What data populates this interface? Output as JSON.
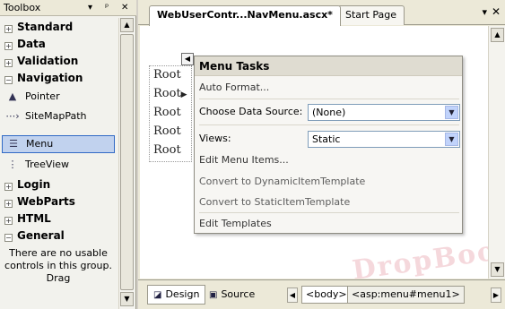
{
  "toolbox": {
    "title": "Toolbox",
    "pin_glyph": "▾ ᵖ",
    "close_glyph": "✕",
    "groups": [
      {
        "label": "Standard",
        "expander": "+"
      },
      {
        "label": "Data",
        "expander": "+"
      },
      {
        "label": "Validation",
        "expander": "+"
      },
      {
        "label": "Navigation",
        "expander": "−"
      }
    ],
    "items": [
      {
        "label": "Pointer",
        "icon": "pointer-icon",
        "glyph": "▲"
      },
      {
        "label": "SiteMapPath",
        "icon": "sitemappath-icon",
        "glyph": "⋯›"
      },
      {
        "label": "Menu",
        "icon": "menu-icon",
        "glyph": "☰"
      },
      {
        "label": "TreeView",
        "icon": "treeview-icon",
        "glyph": "⋮"
      }
    ],
    "groups_after": [
      {
        "label": "Login",
        "expander": "+"
      },
      {
        "label": "WebParts",
        "expander": "+"
      },
      {
        "label": "HTML",
        "expander": "+"
      },
      {
        "label": "General",
        "expander": "−"
      }
    ],
    "empty_text": "There are no usable controls in this group. Drag"
  },
  "editor": {
    "tabs": [
      {
        "label": "WebUserContr...NavMenu.ascx*"
      },
      {
        "label": "Start Page"
      }
    ],
    "tab_menu_glyph": "▾",
    "tab_close_glyph": "✕",
    "menu_items": [
      "Root",
      "Root",
      "Root",
      "Root",
      "Root"
    ],
    "tasks": {
      "title": "Menu Tasks",
      "auto_format": "Auto Format...",
      "data_source_label": "Choose Data Source:",
      "data_source_value": "(None)",
      "views_label": "Views:",
      "views_value": "Static",
      "edit_menu_items": "Edit Menu Items...",
      "convert_dynamic": "Convert to DynamicItemTemplate",
      "convert_static": "Convert to StaticItemTemplate",
      "edit_templates": "Edit Templates"
    },
    "watermark": "DropBooks",
    "bottom": {
      "design_label": "Design",
      "source_label": "Source",
      "tag_body": "<body>",
      "tag_menu": "<asp:menu#menu1>"
    }
  }
}
